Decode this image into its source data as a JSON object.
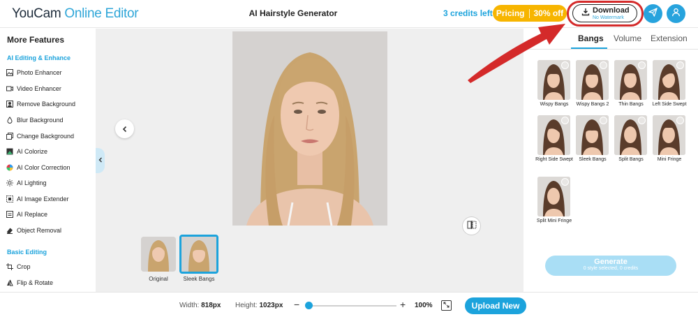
{
  "header": {
    "logo_brand": "YouCam",
    "logo_sub": "Online Editor",
    "title": "AI Hairstyle Generator",
    "credits": "3 credits left",
    "pricing_label": "Pricing",
    "pricing_discount": "30% off",
    "download_label": "Download",
    "download_sub": "No Watermark"
  },
  "sidebar": {
    "title": "More Features",
    "sections": [
      {
        "label": "AI Editing & Enhance",
        "items": [
          {
            "label": "Photo Enhancer",
            "icon": "image-icon"
          },
          {
            "label": "Video Enhancer",
            "icon": "video-icon"
          },
          {
            "label": "Remove Background",
            "icon": "cutout-icon"
          },
          {
            "label": "Blur Background",
            "icon": "drop-icon"
          },
          {
            "label": "Change Background",
            "icon": "layers-icon"
          },
          {
            "label": "AI Colorize",
            "icon": "palette-icon"
          },
          {
            "label": "AI Color Correction",
            "icon": "color-wheel-icon"
          },
          {
            "label": "AI Lighting",
            "icon": "sun-icon"
          },
          {
            "label": "AI Image Extender",
            "icon": "expand-icon"
          },
          {
            "label": "AI Replace",
            "icon": "replace-icon"
          },
          {
            "label": "Object Removal",
            "icon": "eraser-icon"
          }
        ]
      },
      {
        "label": "Basic Editing",
        "items": [
          {
            "label": "Crop",
            "icon": "crop-icon"
          },
          {
            "label": "Flip & Rotate",
            "icon": "flip-icon"
          }
        ]
      }
    ]
  },
  "canvas": {
    "thumbnails": [
      {
        "label": "Original",
        "selected": false
      },
      {
        "label": "Sleek Bangs",
        "selected": true
      }
    ]
  },
  "panel": {
    "tabs": [
      {
        "label": "Bangs",
        "active": true
      },
      {
        "label": "Volume",
        "active": false
      },
      {
        "label": "Extension",
        "active": false
      }
    ],
    "styles": [
      {
        "label": "Wispy Bangs"
      },
      {
        "label": "Wispy Bangs 2"
      },
      {
        "label": "Thin Bangs"
      },
      {
        "label": "Left Side Swept"
      },
      {
        "label": "Right Side Swept"
      },
      {
        "label": "Sleek Bangs"
      },
      {
        "label": "Split Bangs"
      },
      {
        "label": "Mini Fringe"
      },
      {
        "label": "Split Mini Fringe"
      }
    ],
    "generate_label": "Generate",
    "generate_sub": "0 style selected, 0 credits"
  },
  "bottom": {
    "width_label": "Width:",
    "width_value": "818px",
    "height_label": "Height:",
    "height_value": "1023px",
    "zoom_minus": "−",
    "zoom_plus": "+",
    "zoom_value": "100%",
    "zoom_level": 0.0,
    "upload_label": "Upload New"
  },
  "colors": {
    "accent": "#1ca3dc",
    "pricing": "#f7b500",
    "annotation": "#d42a2a"
  }
}
